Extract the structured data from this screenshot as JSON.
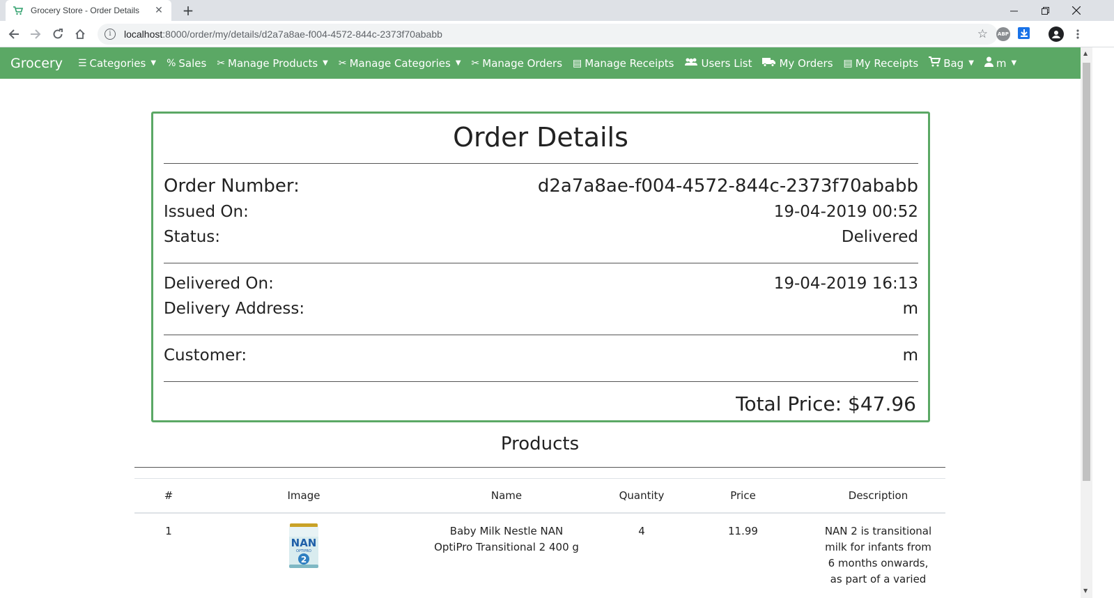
{
  "browser": {
    "tab_title": "Grocery Store - Order Details",
    "url_host": "localhost",
    "url_rest": ":8000/order/my/details/d2a7a8ae-f004-4572-844c-2373f70ababb"
  },
  "navbar": {
    "brand": "Grocery",
    "items": [
      {
        "label": "Categories",
        "icon": "list-icon",
        "dropdown": true
      },
      {
        "label": "Sales",
        "icon": "percent-icon",
        "dropdown": false
      },
      {
        "label": "Manage Products",
        "icon": "tools-icon",
        "dropdown": true
      },
      {
        "label": "Manage Categories",
        "icon": "tools-icon",
        "dropdown": true
      },
      {
        "label": "Manage Orders",
        "icon": "tools-icon",
        "dropdown": false
      },
      {
        "label": "Manage Receipts",
        "icon": "file-icon",
        "dropdown": false
      },
      {
        "label": "Users List",
        "icon": "users-icon",
        "dropdown": false
      },
      {
        "label": "My Orders",
        "icon": "truck-icon",
        "dropdown": false
      },
      {
        "label": "My Receipts",
        "icon": "file-icon",
        "dropdown": false
      },
      {
        "label": "Bag",
        "icon": "cart-icon",
        "dropdown": true
      },
      {
        "label": "m",
        "icon": "user-icon",
        "dropdown": true
      }
    ]
  },
  "order": {
    "title": "Order Details",
    "number_label": "Order Number:",
    "number": "d2a7a8ae-f004-4572-844c-2373f70ababb",
    "issued_label": "Issued On:",
    "issued": "19-04-2019 00:52",
    "status_label": "Status:",
    "status": "Delivered",
    "delivered_label": "Delivered On:",
    "delivered": "19-04-2019 16:13",
    "address_label": "Delivery Address:",
    "address": "m",
    "customer_label": "Customer:",
    "customer": "m",
    "total": "Total Price: $47.96"
  },
  "products": {
    "title": "Products",
    "headers": [
      "#",
      "Image",
      "Name",
      "Quantity",
      "Price",
      "Description"
    ],
    "rows": [
      {
        "index": "1",
        "name": "Baby Milk Nestle NAN OptiPro Transitional 2 400 g",
        "quantity": "4",
        "price": "11.99",
        "description": "NAN 2 is transitional milk for infants from 6 months onwards, as part of a varied",
        "image_text": "NAN",
        "image_sub": "OPTIPRO",
        "image_num": "2"
      }
    ]
  },
  "colors": {
    "accent": "#5ba865"
  }
}
